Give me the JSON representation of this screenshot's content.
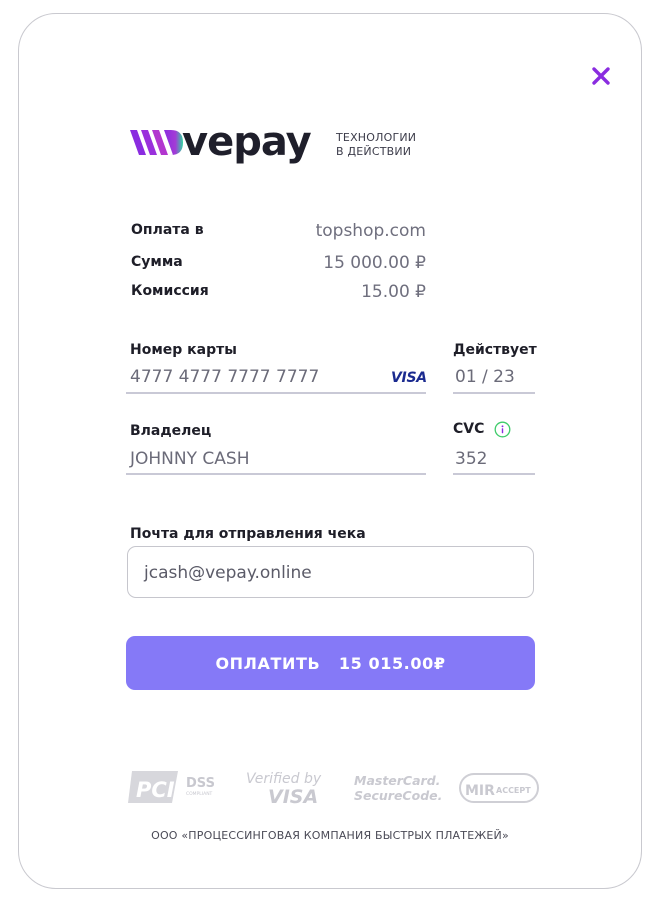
{
  "brand": {
    "logo_text": "vepay",
    "tagline_line1": "ТЕХНОЛОГИИ",
    "tagline_line2": "В ДЕЙСТВИИ",
    "accent_color": "#8a2ce0",
    "button_color": "#8579f7"
  },
  "summary": {
    "merchant_label": "Оплата в",
    "merchant_value": "topshop.com",
    "amount_label": "Сумма",
    "amount_value": "15 000.00 ₽",
    "fee_label": "Комиссия",
    "fee_value": "15.00 ₽"
  },
  "card": {
    "number_label": "Номер карты",
    "number_value": "4777 4777 7777 7777",
    "brand_mark": "VISA",
    "expiry_label": "Действует",
    "expiry_value": "01 / 23",
    "holder_label": "Владелец",
    "holder_value": "JOHNNY CASH",
    "cvc_label": "CVC",
    "cvc_value": "352"
  },
  "receipt": {
    "email_label": "Почта для отправления чека",
    "email_value": "jcash@vepay.online"
  },
  "pay_button": {
    "label": "ОПЛАТИТЬ",
    "amount": "15 015.00₽"
  },
  "badges": {
    "pci": "PCI",
    "dss": "DSS",
    "compliant": "COMPLIANT",
    "verified_line1": "Verified by",
    "verified_line2": "VISA",
    "mc_line1": "MasterCard.",
    "mc_line2": "SecureCode.",
    "mir": "MIR",
    "accept": "ACCEPT"
  },
  "icons": {
    "close": "close-icon",
    "info": "info-icon"
  },
  "footer": {
    "company": "ООО «ПРОЦЕССИНГОВАЯ КОМПАНИЯ БЫСТРЫХ ПЛАТЕЖЕЙ»"
  }
}
